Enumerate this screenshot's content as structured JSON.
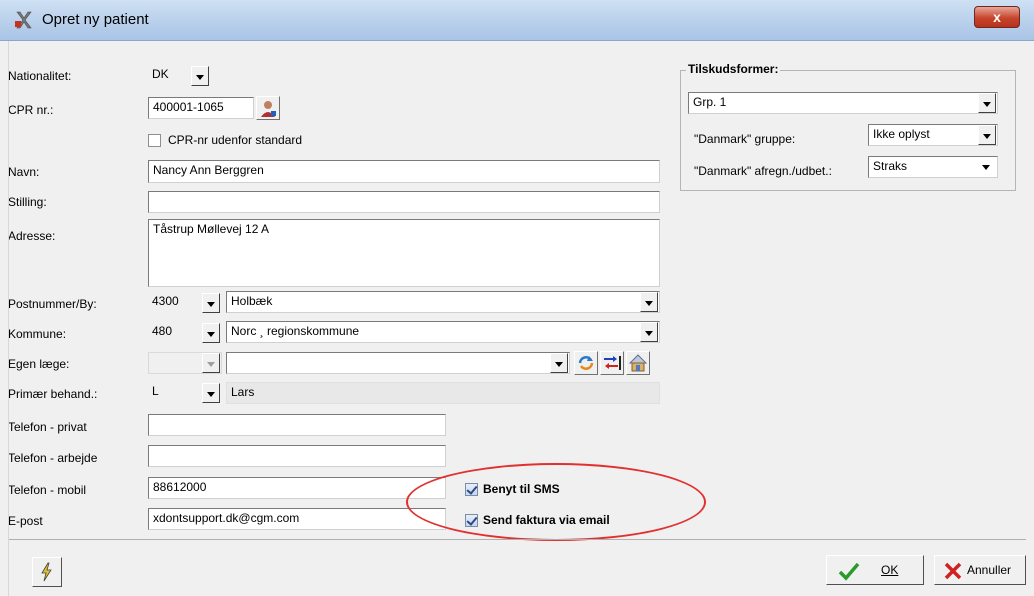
{
  "window": {
    "title": "Opret ny patient",
    "close_label": "x"
  },
  "form": {
    "nationalitet": {
      "label": "Nationalitet:",
      "value": "DK"
    },
    "cpr": {
      "label": "CPR nr.:",
      "value": "400001-1065"
    },
    "cpr_outside": {
      "label": "CPR-nr udenfor standard",
      "checked": false
    },
    "navn": {
      "label": "Navn:",
      "value": "Nancy Ann Berggren"
    },
    "stilling": {
      "label": "Stilling:",
      "value": ""
    },
    "adresse": {
      "label": "Adresse:",
      "value": "Tåstrup Møllevej 12 A"
    },
    "postnummer": {
      "label": "Postnummer/By:",
      "code": "4300",
      "city": "Holbæk"
    },
    "kommune": {
      "label": "Kommune:",
      "code": "480",
      "name": "Norc ¸     regionskommune"
    },
    "egen_laege": {
      "label": "Egen læge:",
      "code": "",
      "name": ""
    },
    "primaer": {
      "label": "Primær behand.:",
      "code": "L",
      "name": "Lars"
    },
    "tlf_privat": {
      "label": "Telefon - privat",
      "value": ""
    },
    "tlf_arbejde": {
      "label": "Telefon - arbejde",
      "value": ""
    },
    "tlf_mobil": {
      "label": "Telefon - mobil",
      "value": "88612000"
    },
    "email": {
      "label": "E-post",
      "value": "xdontsupport.dk@cgm.com"
    },
    "sms": {
      "label": "Benyt til SMS",
      "checked": true
    },
    "faktura_email": {
      "label": "Send faktura via email",
      "checked": true
    }
  },
  "tilskud": {
    "title": "Tilskudsformer:",
    "group_value": "Grp. 1",
    "danmark_gruppe": {
      "label": "\"Danmark\" gruppe:",
      "value": "Ikke oplyst"
    },
    "danmark_afregn": {
      "label": "\"Danmark\" afregn./udbet.:",
      "value": "Straks"
    }
  },
  "buttons": {
    "ok": "OK",
    "annuller": "Annuller"
  },
  "colors": {
    "highlight_ellipse": "#e23030",
    "titlebar": "#b7cfeb",
    "close": "#c7452d"
  }
}
